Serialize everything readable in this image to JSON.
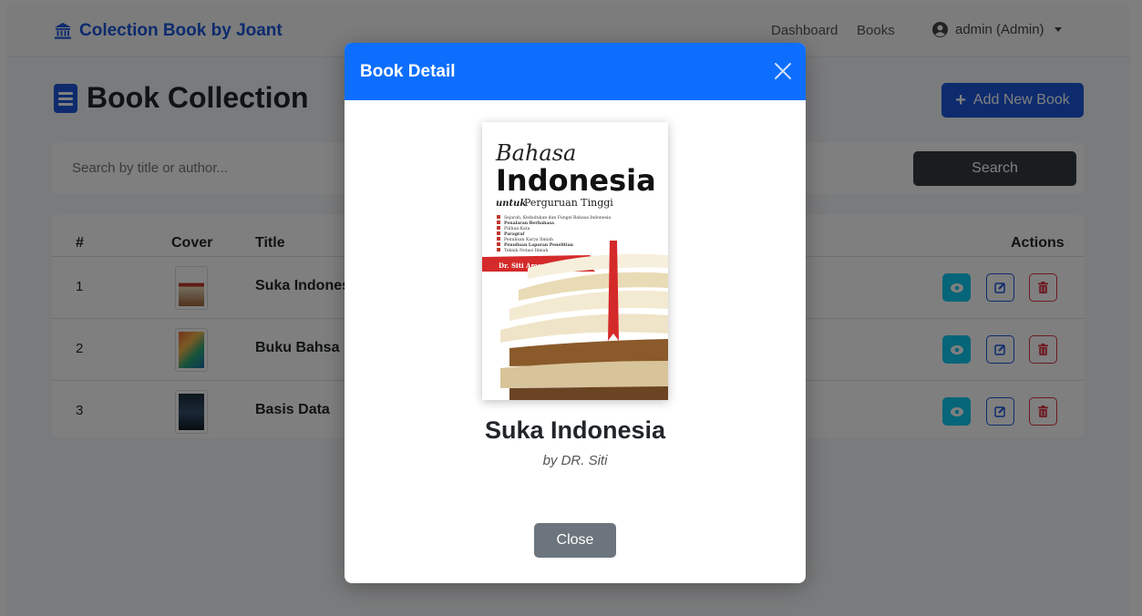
{
  "navbar": {
    "brand": "Colection Book by Joant",
    "links": [
      "Dashboard",
      "Books"
    ],
    "user": "admin (Admin)"
  },
  "header": {
    "title": "Book Collection",
    "add_label": "Add New Book"
  },
  "search": {
    "placeholder": "Search by title or author...",
    "button_label": "Search"
  },
  "table": {
    "headers": [
      "#",
      "Cover",
      "Title",
      "Actions"
    ],
    "rows": [
      {
        "num": "1",
        "title": "Suka Indonesia"
      },
      {
        "num": "2",
        "title": "Buku Bahsa Inggris"
      },
      {
        "num": "3",
        "title": "Basis Data"
      }
    ]
  },
  "modal": {
    "title": "Book Detail",
    "book_title": "Suka Indonesia",
    "book_author": "by DR. Siti",
    "close_label": "Close",
    "cover": {
      "line1": "Bahasa",
      "line2": "Indonesia",
      "line3a": "untuk",
      "line3b": "Perguruan Tinggi",
      "bullets": [
        "Sejarah, Kedudukan dan Fungsi Bahasa Indonesia",
        "Penalaran Berbahasa",
        "Pilihan Kata",
        "Paragraf",
        "Penulisan Karya Ilmiah",
        "Penulisan Laporan Penelitian",
        "Teknik Notasi Ilmiah"
      ],
      "author_ribbon": "Dr. Siti Amsoriyah, M.Pd."
    }
  },
  "colors": {
    "primary": "#1a56db",
    "modal_header": "#0d6efd",
    "view": "#0dcaf0",
    "delete": "#dc3545",
    "dark": "#343a40",
    "secondary": "#6c757d"
  }
}
